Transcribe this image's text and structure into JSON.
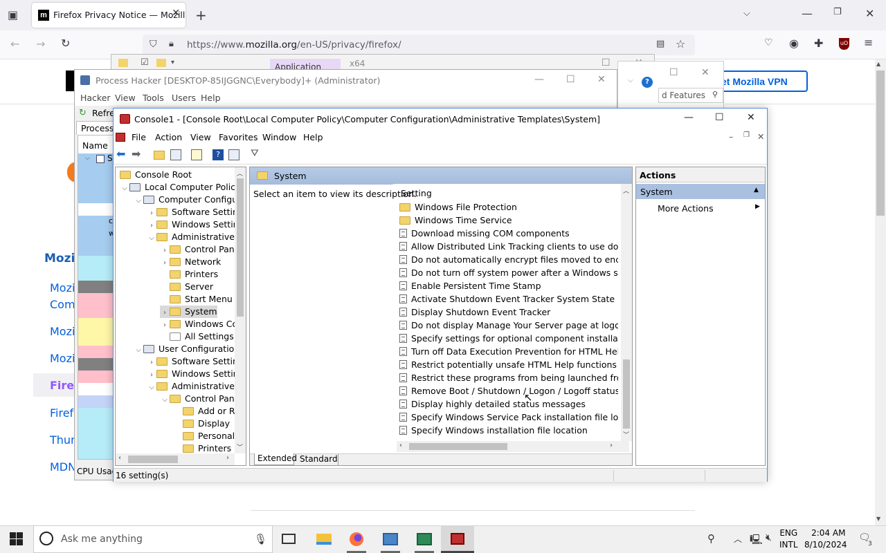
{
  "browser": {
    "tab_title": "Firefox Privacy Notice — Mozill",
    "tab_favicon": "m",
    "url_prefix": "https://www.",
    "url_domain": "mozilla.org",
    "url_path": "/en-US/privacy/firefox/"
  },
  "page": {
    "vpn_button": "et Mozilla VPN",
    "heading": "Mozi",
    "links": [
      "Mozi",
      "Com",
      "Mozi",
      "Mozi",
      "Firef",
      "Firef",
      "Thun",
      "MDN"
    ]
  },
  "explorer": {
    "app_tools": "Application Tools",
    "arch": "x64",
    "search": "d Features"
  },
  "process_hacker": {
    "title": "Process Hacker [DESKTOP-85IJGGNC\\Everybody]+ (Administrator)",
    "menu": [
      "Hacker",
      "View",
      "Tools",
      "Users",
      "Help"
    ],
    "refresh": "Refres",
    "tab": "Processes",
    "col_name": "Name",
    "cpu": "CPU Usag",
    "rows": [
      "S",
      "",
      "",
      "cs",
      "w",
      ""
    ]
  },
  "console": {
    "title": "Console1 - [Console Root\\Local Computer Policy\\Computer Configuration\\Administrative Templates\\System]",
    "menu": [
      "File",
      "Action",
      "View",
      "Favorites",
      "Window",
      "Help"
    ],
    "tree": [
      {
        "label": "Console Root",
        "exp": "",
        "level": 0
      },
      {
        "label": "Local Computer Policy",
        "exp": "v",
        "level": 0
      },
      {
        "label": "Computer Configura",
        "exp": "v",
        "level": 1
      },
      {
        "label": "Software Settings",
        "exp": ">",
        "level": 2
      },
      {
        "label": "Windows Setting",
        "exp": ">",
        "level": 2
      },
      {
        "label": "Administrative Te",
        "exp": "v",
        "level": 2
      },
      {
        "label": "Control Panel",
        "exp": ">",
        "level": 3
      },
      {
        "label": "Network",
        "exp": ">",
        "level": 3
      },
      {
        "label": "Printers",
        "exp": "",
        "level": 3
      },
      {
        "label": "Server",
        "exp": "",
        "level": 3
      },
      {
        "label": "Start Menu ar",
        "exp": "",
        "level": 3
      },
      {
        "label": "System",
        "exp": ">",
        "level": 3
      },
      {
        "label": "Windows Cor",
        "exp": ">",
        "level": 3
      },
      {
        "label": "All Settings",
        "exp": "",
        "level": 3
      },
      {
        "label": "User Configuration",
        "exp": "v",
        "level": 1
      },
      {
        "label": "Software Settings",
        "exp": ">",
        "level": 2
      },
      {
        "label": "Windows Setting",
        "exp": ">",
        "level": 2
      },
      {
        "label": "Administrative Te",
        "exp": "v",
        "level": 2
      },
      {
        "label": "Control Panel",
        "exp": "v",
        "level": 3
      },
      {
        "label": "Add or Re",
        "exp": "",
        "level": 4
      },
      {
        "label": "Display",
        "exp": "",
        "level": 4
      },
      {
        "label": "Personaliz",
        "exp": "",
        "level": 4
      },
      {
        "label": "Printers",
        "exp": "",
        "level": 4
      }
    ],
    "center_header": "System",
    "description": "Select an item to view its description.",
    "column_setting": "Setting",
    "folders": [
      "Windows File Protection",
      "Windows Time Service"
    ],
    "settings": [
      "Download missing COM components",
      "Allow Distributed Link Tracking clients to use domain res",
      "Do not automatically encrypt files moved to encrypted fo",
      "Do not turn off system power after a Windows system sh",
      "Enable Persistent Time Stamp",
      "Activate Shutdown Event Tracker System State Data featu",
      "Display Shutdown Event Tracker",
      "Do not display Manage Your Server page at logon",
      "Specify settings for optional component installation and",
      "Turn off Data Execution Prevention for HTML Help Execu",
      "Restrict potentially unsafe HTML Help functions to specif",
      "Restrict these programs from being launched from Help",
      "Remove Boot / Shutdown / Logon / Logoff status messa",
      "Display highly detailed status messages",
      "Specify Windows Service Pack installation file location",
      "Specify Windows installation file location"
    ],
    "tab_extended": "Extended",
    "tab_standard": "Standard",
    "actions_header": "Actions",
    "actions_section": "System",
    "more_actions": "More Actions",
    "status": "16 setting(s)"
  },
  "taskbar": {
    "search_placeholder": "Ask me anything",
    "lang1": "ENG",
    "lang2": "INTL",
    "time": "2:04 AM",
    "date": "8/10/2024",
    "notifications": "3"
  }
}
